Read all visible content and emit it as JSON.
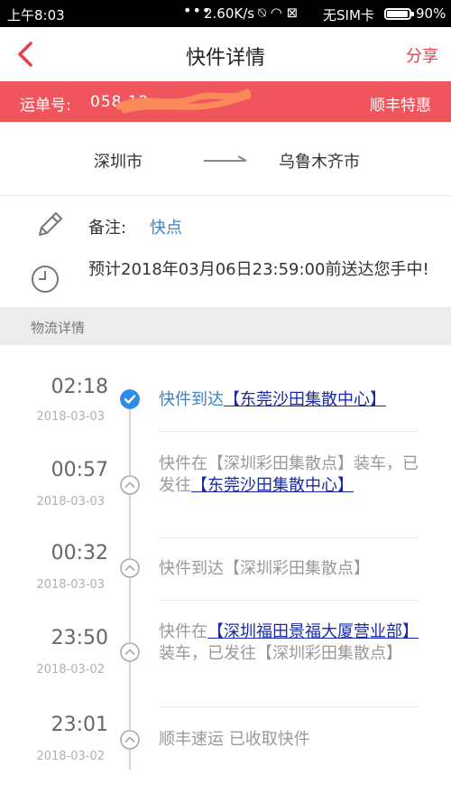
{
  "status_bar": {
    "time": "上午8:03",
    "dots": "•••",
    "speed": "2.60K/s",
    "icons": "⍉ ◠ ⊠",
    "carrier": "无SIM卡",
    "battery": "90%"
  },
  "nav": {
    "title": "快件详情",
    "share": "分享"
  },
  "waybill": {
    "label": "运单号:",
    "number": "058 12",
    "service": "顺丰特惠"
  },
  "route": {
    "from": "深圳市",
    "to": "乌鲁木齐市"
  },
  "note": {
    "label": "备注:",
    "value": "快点"
  },
  "eta": {
    "text": "预计2018年03月06日23:59:00前送达您手中!"
  },
  "section": {
    "title": "物流详情"
  },
  "events": [
    {
      "time": "02:18",
      "date": "2018-03-03",
      "status": "current",
      "pre": "快件到达",
      "link": "【东莞沙田集散中心】",
      "post": ""
    },
    {
      "time": "00:57",
      "date": "2018-03-03",
      "status": "past",
      "pre": "快件在【深圳彩田集散点】装车，已发往",
      "link": "【东莞沙田集散中心】",
      "post": ""
    },
    {
      "time": "00:32",
      "date": "2018-03-03",
      "status": "past",
      "pre": "快件到达【深圳彩田集散点】",
      "link": "",
      "post": ""
    },
    {
      "time": "23:50",
      "date": "2018-03-02",
      "status": "past",
      "pre": "快件在",
      "link": "【深圳福田景福大厦营业部】",
      "post": "装车，已发往【深圳彩田集散点】"
    },
    {
      "time": "23:01",
      "date": "2018-03-02",
      "status": "past",
      "pre": "顺丰速运 已收取快件",
      "link": "",
      "post": ""
    }
  ],
  "colors": {
    "accent": "#f0545d",
    "link_blue": "#3a82c8",
    "link_dark": "#1a2aa6"
  }
}
